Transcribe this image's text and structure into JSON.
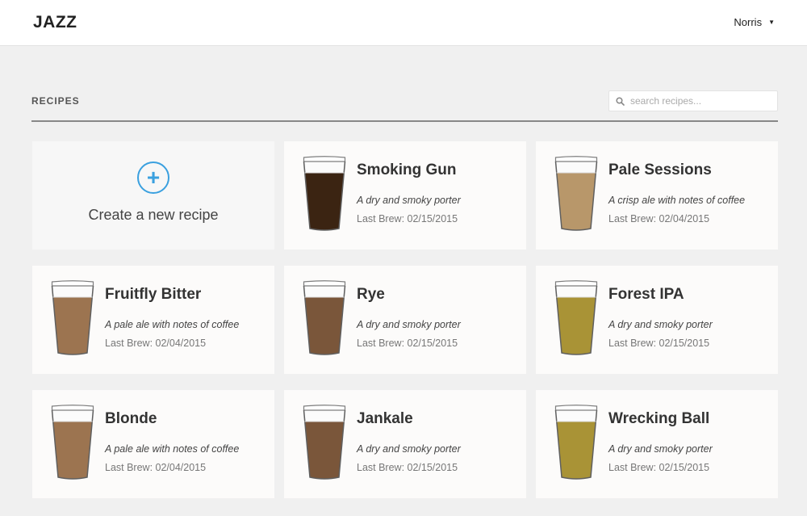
{
  "header": {
    "logo": "JAZZ",
    "user_name": "Norris"
  },
  "section": {
    "title": "RECIPES",
    "search_placeholder": "search recipes..."
  },
  "create_card": {
    "label": "Create a new recipe"
  },
  "recipes": [
    {
      "name": "Smoking Gun",
      "description": "A dry and smoky porter",
      "last_brew": "Last Brew: 02/15/2015",
      "beer_color": "#3b2412"
    },
    {
      "name": "Pale Sessions",
      "description": "A crisp ale with notes of coffee",
      "last_brew": "Last Brew: 02/04/2015",
      "beer_color": "#b8976a"
    },
    {
      "name": "Fruitfly Bitter",
      "description": "A pale ale with notes of coffee",
      "last_brew": "Last Brew: 02/04/2015",
      "beer_color": "#9c7450"
    },
    {
      "name": "Rye",
      "description": "A dry and smoky porter",
      "last_brew": "Last Brew: 02/15/2015",
      "beer_color": "#7a563a"
    },
    {
      "name": "Forest IPA",
      "description": "A dry and smoky porter",
      "last_brew": "Last Brew: 02/15/2015",
      "beer_color": "#a99336"
    },
    {
      "name": "Blonde",
      "description": "A pale ale with notes of coffee",
      "last_brew": "Last Brew: 02/04/2015",
      "beer_color": "#9c7450"
    },
    {
      "name": "Jankale",
      "description": "A dry and smoky porter",
      "last_brew": "Last Brew: 02/15/2015",
      "beer_color": "#7a563a"
    },
    {
      "name": "Wrecking Ball",
      "description": "A dry and smoky porter",
      "last_brew": "Last Brew: 02/15/2015",
      "beer_color": "#a99336"
    }
  ],
  "colors": {
    "accent": "#3aa0df",
    "background": "#f0f0f0",
    "card": "#fcfbfa"
  },
  "icons": {
    "search": "search-icon",
    "user_caret": "caret-down-icon",
    "create": "plus-circle-icon",
    "recipe": "beer-glass-icon"
  }
}
